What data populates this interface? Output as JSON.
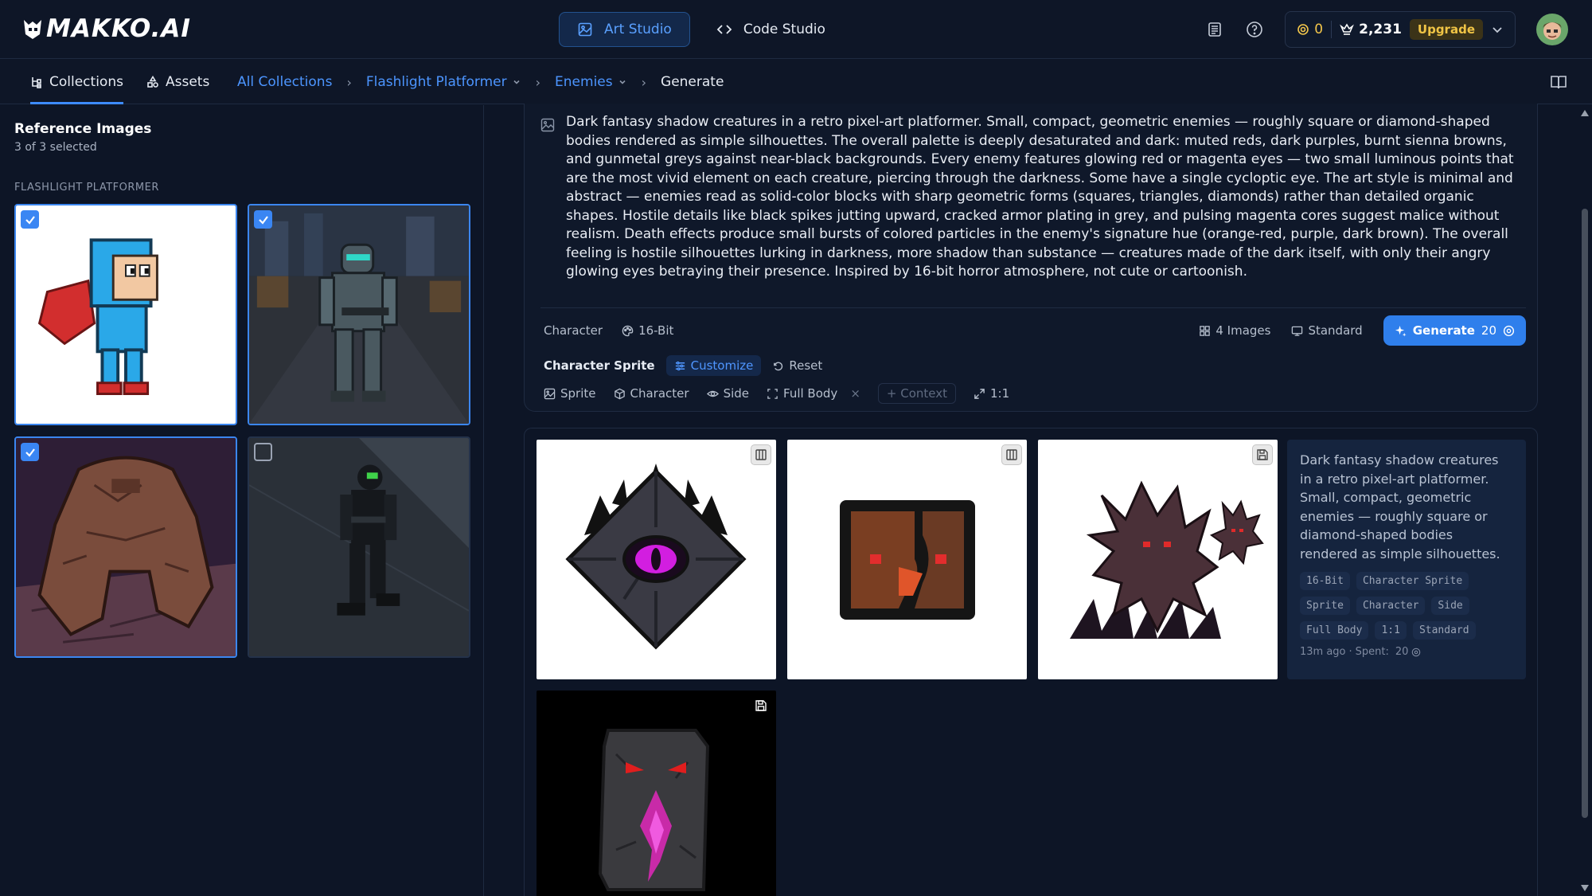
{
  "app": {
    "logo_text": "MAKKO.AI",
    "tabs": [
      {
        "label": "Art Studio",
        "icon": "image-icon",
        "active": true
      },
      {
        "label": "Code Studio",
        "icon": "code-icon",
        "active": false
      }
    ],
    "coins": "0",
    "crowns": "2,231",
    "upgrade_label": "Upgrade"
  },
  "subnav": {
    "tabs": [
      {
        "label": "Collections",
        "active": true
      },
      {
        "label": "Assets",
        "active": false
      }
    ],
    "breadcrumb": [
      "All Collections",
      "Flashlight Platformer",
      "Enemies",
      "Generate"
    ]
  },
  "reference": {
    "title": "Reference Images",
    "count_text": "3 of 3 selected",
    "section_label": "FLASHLIGHT PLATFORMER",
    "images": [
      {
        "name": "blue-helmet-hero",
        "selected": true
      },
      {
        "name": "armored-soldier",
        "selected": true
      },
      {
        "name": "rock-golem",
        "selected": true
      },
      {
        "name": "night-vision-operative",
        "selected": false
      }
    ]
  },
  "prompt": {
    "text": "Dark fantasy shadow creatures in a retro pixel-art platformer. Small, compact, geometric enemies — roughly square or diamond-shaped bodies rendered as simple silhouettes. The overall palette is deeply desaturated and dark: muted reds, dark purples, burnt sienna browns, and gunmetal greys against near-black backgrounds. Every enemy features glowing red or magenta eyes — two small luminous points that are the most vivid element on each creature, piercing through the darkness. Some have a single cycloptic eye. The art style is minimal and abstract — enemies read as solid-color blocks with sharp geometric forms (squares, triangles, diamonds) rather than detailed organic shapes. Hostile details like black spikes jutting upward, cracked armor plating in grey, and pulsing magenta cores suggest malice without realism. Death effects produce small bursts of colored particles in the enemy's signature hue (orange-red, purple, dark brown). The overall feeling is hostile silhouettes lurking in darkness, more shadow than substance — creatures made of the dark itself, with only their angry glowing eyes betraying their presence. Inspired by 16-bit horror atmosphere, not cute or cartoonish.",
    "type_label": "Character",
    "style_label": "16-Bit",
    "images_label": "4 Images",
    "quality_label": "Standard",
    "generate_label": "Generate",
    "generate_cost": "20",
    "preset_label": "Character Sprite",
    "customize_label": "Customize",
    "reset_label": "Reset",
    "options": [
      "Sprite",
      "Character",
      "Side",
      "Full Body"
    ],
    "context_label": "+ Context",
    "ratio_label": "1:1"
  },
  "result": {
    "description": "Dark fantasy shadow creatures in a retro pixel-art platformer. Small, compact, geometric enemies — roughly square or diamond-shaped bodies rendered as simple silhouettes. The overall palette is...",
    "tags": [
      "16-Bit",
      "Character Sprite",
      "Sprite",
      "Character",
      "Side",
      "Full Body",
      "1:1",
      "Standard"
    ],
    "time_ago": "13m ago",
    "spent_label": "Spent:",
    "spent_value": "20"
  },
  "colors": {
    "accent": "#2f7fec",
    "link": "#4c95ff",
    "background": "#0d1526",
    "gold": "#f3c64b"
  }
}
